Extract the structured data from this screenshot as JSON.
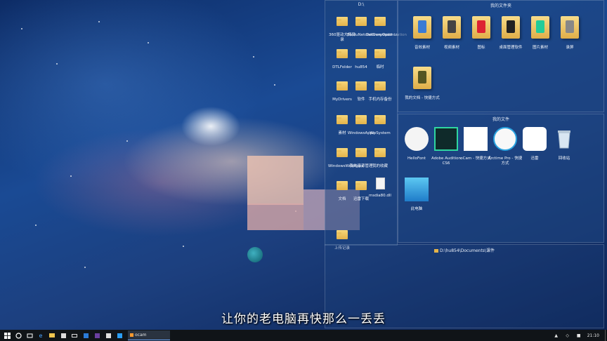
{
  "fences": {
    "d_drive": {
      "title": "D:\\",
      "items": [
        {
          "label": "360驱动大师目录",
          "icon": "folder-icon"
        },
        {
          "label": "BaiduNetdiskDownload",
          "icon": "folder-icon"
        },
        {
          "label": "DeliveryOptimization",
          "icon": "folder-icon"
        },
        {
          "label": "DTLFolder",
          "icon": "folder-icon"
        },
        {
          "label": "hu854",
          "icon": "folder-icon"
        },
        {
          "label": "临时",
          "icon": "folder-icon"
        },
        {
          "label": "MyDrivers",
          "icon": "folder-icon"
        },
        {
          "label": "软件",
          "icon": "folder-icon"
        },
        {
          "label": "手机内存备份",
          "icon": "folder-icon"
        },
        {
          "label": "素材",
          "icon": "folder-icon"
        },
        {
          "label": "WindowsApps",
          "icon": "folder-icon"
        },
        {
          "label": "WpSystem",
          "icon": "folder-icon"
        },
        {
          "label": "WindowsWebApps",
          "icon": "folder-icon"
        },
        {
          "label": "我的资源管理",
          "icon": "folder-icon"
        },
        {
          "label": "我的收藏",
          "icon": "folder-icon"
        },
        {
          "label": "文档",
          "icon": "folder-icon"
        },
        {
          "label": "迅雷下载",
          "icon": "folder-icon"
        },
        {
          "label": "msdia80.dll",
          "icon": "dll-file-icon"
        },
        {
          "label": "上传记录",
          "icon": "folder-icon"
        }
      ]
    },
    "my_folders": {
      "title": "我的文件夹",
      "items": [
        {
          "label": "音效素材",
          "icon": "audio-folder-icon"
        },
        {
          "label": "视频素材",
          "icon": "video-folder-icon"
        },
        {
          "label": "图标",
          "icon": "qq-folder-icon"
        },
        {
          "label": "桌面管理软件",
          "icon": "app-folder-icon"
        },
        {
          "label": "图片素材",
          "icon": "image-folder-icon"
        },
        {
          "label": "录屏",
          "icon": "screen-folder-icon"
        },
        {
          "label": "我的文档 - 快捷方式",
          "icon": "shortcut-folder-icon"
        }
      ]
    },
    "my_files": {
      "title": "我的文件",
      "items": [
        {
          "label": "HelloFont",
          "icon": "hellofont-icon"
        },
        {
          "label": "Adobe Audition CS6",
          "icon": "audition-icon"
        },
        {
          "label": "oCam - 快捷方式",
          "icon": "ocam-icon"
        },
        {
          "label": "Arctime Pro - 快捷方式",
          "icon": "arctime-icon"
        },
        {
          "label": "迅雷",
          "icon": "thunder-icon"
        },
        {
          "label": "回收站",
          "icon": "recycle-bin-icon"
        },
        {
          "label": "此电脑",
          "icon": "this-pc-icon"
        }
      ]
    },
    "documents_path": {
      "title": "D:\\hu854\\Documents\\课件"
    }
  },
  "subtitle": "让你的老电脑再快那么一丢丢",
  "taskbar": {
    "active_app": "ocam",
    "clock": "21:10",
    "tray_icons": [
      "speaker-icon",
      "network-icon",
      "ime-icon"
    ]
  },
  "colors": {
    "fence_bg": "#1e4682",
    "taskbar_bg": "#101418"
  }
}
